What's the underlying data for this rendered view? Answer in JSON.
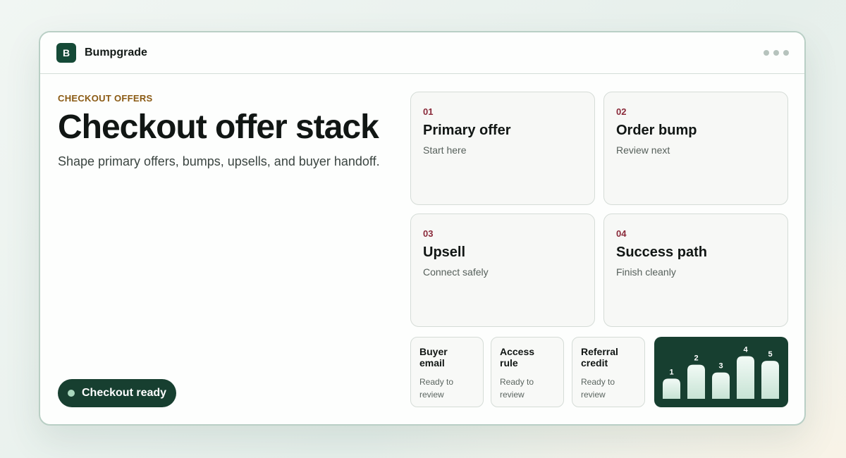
{
  "app": {
    "logo_letter": "B",
    "name": "Bumpgrade"
  },
  "hero": {
    "eyebrow": "CHECKOUT OFFERS",
    "title": "Checkout offer stack",
    "subtitle": "Shape primary offers, bumps, upsells, and buyer handoff."
  },
  "status": {
    "label": "Checkout ready"
  },
  "steps": [
    {
      "num": "01",
      "title": "Primary offer",
      "sub": "Start here"
    },
    {
      "num": "02",
      "title": "Order bump",
      "sub": "Review next"
    },
    {
      "num": "03",
      "title": "Upsell",
      "sub": "Connect safely"
    },
    {
      "num": "04",
      "title": "Success path",
      "sub": "Finish cleanly"
    }
  ],
  "checks": [
    {
      "title": "Buyer email",
      "sub": "Ready to review"
    },
    {
      "title": "Access rule",
      "sub": "Ready to review"
    },
    {
      "title": "Referral credit",
      "sub": "Ready to review"
    }
  ],
  "colors": {
    "brand": "#154a37",
    "accent_label": "#8a5a13",
    "step_number": "#8a2a3a"
  },
  "chart_data": {
    "type": "bar",
    "categories": [
      "1",
      "2",
      "3",
      "4",
      "5"
    ],
    "values": [
      26,
      44,
      34,
      55,
      49
    ],
    "ylim": [
      0,
      60
    ]
  }
}
